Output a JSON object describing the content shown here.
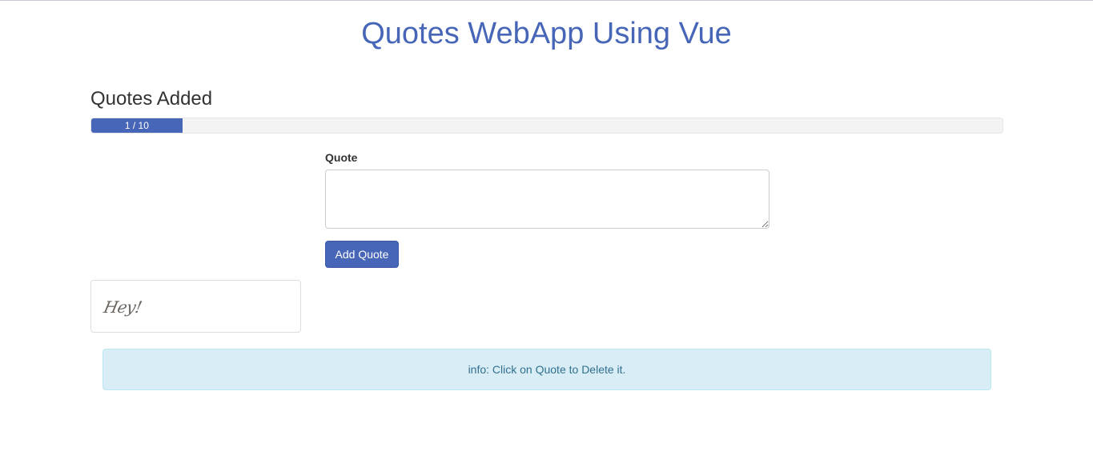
{
  "header": {
    "title": "Quotes WebApp Using Vue"
  },
  "progress": {
    "title": "Quotes Added",
    "label": "1 / 10",
    "current": 1,
    "max": 10,
    "fill_fraction": 0.1,
    "color": "#4766b8"
  },
  "form": {
    "quote_label": "Quote",
    "quote_value": "",
    "add_button_label": "Add Quote"
  },
  "quotes": [
    {
      "text": "Hey!"
    }
  ],
  "alert": {
    "text": "info: Click on Quote to Delete it."
  },
  "colors": {
    "accent": "#4766b8",
    "alert_bg": "#d9edf7",
    "alert_text": "#31708f"
  }
}
